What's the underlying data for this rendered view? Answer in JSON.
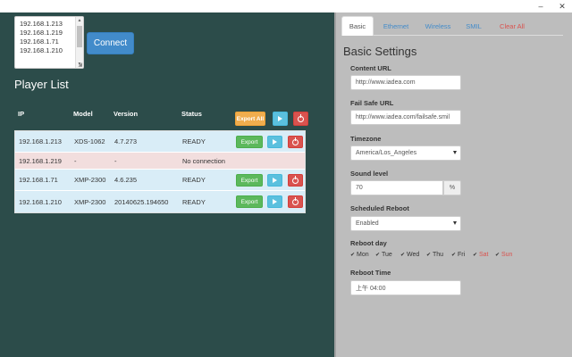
{
  "window": {
    "minimize_glyph": "–",
    "close_glyph": "✕"
  },
  "ip_list": [
    "192.168.1.213",
    "192.168.1.219",
    "192.168.1.71",
    "192.168.1.210"
  ],
  "connect_label": "Connect",
  "player_list": {
    "title": "Player List",
    "columns": {
      "ip": "IP",
      "model": "Model",
      "version": "Version",
      "status": "Status"
    },
    "export_all_label": "Export All",
    "export_label": "Export",
    "rows": [
      {
        "ip": "192.168.1.213",
        "model": "XDS-1062",
        "version": "4.7.273",
        "status": "READY",
        "state": "ok"
      },
      {
        "ip": "192.168.1.219",
        "model": "-",
        "version": "-",
        "status": "No connection",
        "state": "error"
      },
      {
        "ip": "192.168.1.71",
        "model": "XMP-2300",
        "version": "4.6.235",
        "status": "READY",
        "state": "ok"
      },
      {
        "ip": "192.168.1.210",
        "model": "XMP-2300",
        "version": "20140625.194650",
        "status": "READY",
        "state": "ok"
      }
    ]
  },
  "tabs": {
    "basic": "Basic",
    "ethernet": "Ethernet",
    "wireless": "Wireless",
    "smil": "SMIL",
    "clear_all": "Clear All"
  },
  "settings": {
    "title": "Basic Settings",
    "content_url_label": "Content URL",
    "content_url": "http://www.iadea.com",
    "failsafe_url_label": "Fail Safe URL",
    "failsafe_url": "http://www.iadea.com/failsafe.smil",
    "timezone_label": "Timezone",
    "timezone": "America/Los_Angeles",
    "sound_level_label": "Sound level",
    "sound_level": "70",
    "sound_unit": "%",
    "scheduled_reboot_label": "Scheduled Reboot",
    "scheduled_reboot": "Enabled",
    "reboot_day_label": "Reboot day",
    "reboot_days": [
      "Mon",
      "Tue",
      "Wed",
      "Thu",
      "Fri",
      "Sat",
      "Sun"
    ],
    "reboot_time_label": "Reboot Time",
    "reboot_time": "上午 04:00"
  },
  "colors": {
    "left_background": "#2c4c4a",
    "right_background": "#bdbdbd",
    "primary": "#428bca",
    "success": "#5cb85c",
    "warning": "#f0ad4e",
    "info": "#5bc0de",
    "danger": "#d9534f",
    "row_ok": "#d9edf7",
    "row_error": "#f2dede"
  }
}
